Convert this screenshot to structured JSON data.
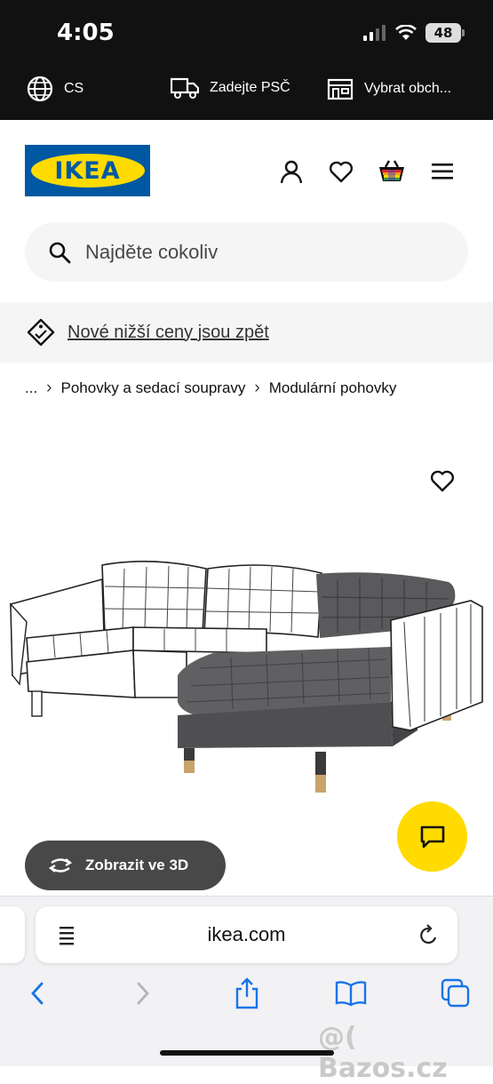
{
  "status": {
    "time": "4:05",
    "battery": "48"
  },
  "topbar": {
    "language": "CS",
    "postcode": "Zadejte PSČ",
    "store": "Vybrat obch..."
  },
  "header": {
    "logo_text": "IKEA",
    "icons": [
      "user-icon",
      "heart-icon",
      "basket-icon",
      "menu-icon"
    ]
  },
  "search": {
    "placeholder": "Najděte cokoliv"
  },
  "banner": {
    "text": "Nové nižší ceny jsou zpět"
  },
  "breadcrumb": {
    "items": [
      "...",
      "Pohovky a sedací soupravy",
      "Modulární pohovky"
    ]
  },
  "product": {
    "view_3d_label": "Zobrazit ve 3D"
  },
  "browser": {
    "url": "ikea.com"
  },
  "watermark": "@( Bazos.cz",
  "colors": {
    "ikea_blue": "#0058a3",
    "ikea_yellow": "#ffdb00",
    "sofa_fabric": "#5a5a5c"
  }
}
